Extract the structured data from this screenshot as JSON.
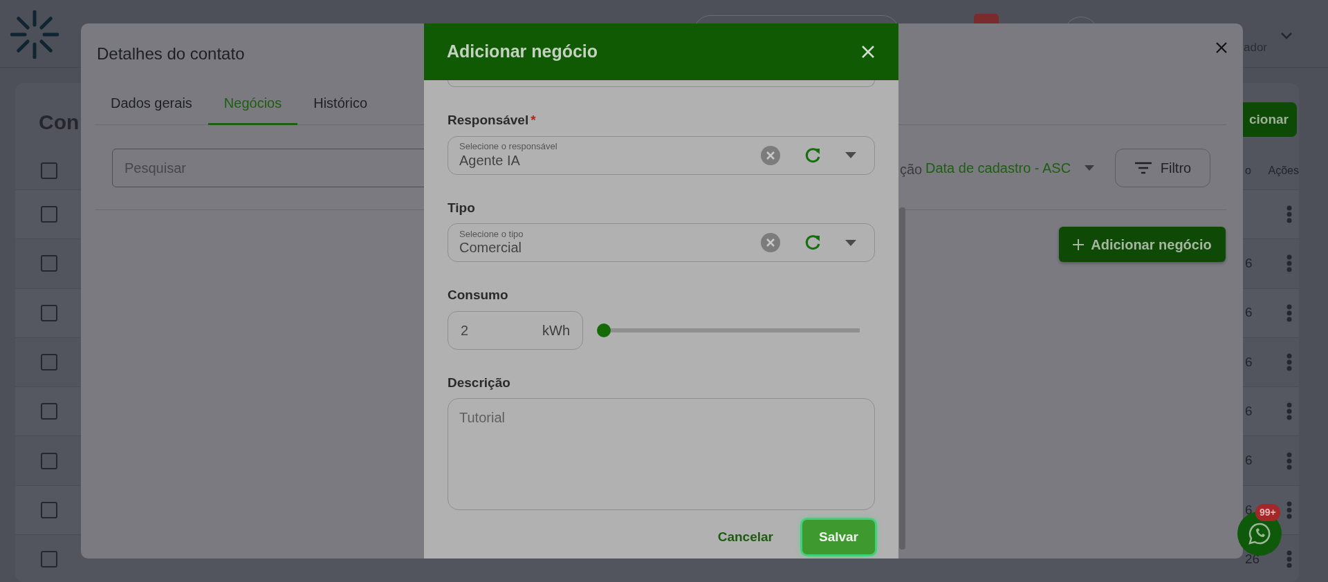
{
  "app": {
    "header": {
      "user_role": "ador"
    },
    "page_title": "Con",
    "add_button": "cionar",
    "table": {
      "columns": [
        "o",
        "Ações"
      ],
      "header_checked": false,
      "rows": [
        {
          "checked": false
        },
        {
          "checked": false,
          "date": "6"
        },
        {
          "checked": false,
          "date": "6"
        },
        {
          "checked": false,
          "date": "6"
        },
        {
          "checked": false,
          "date": "6"
        },
        {
          "checked": false,
          "date": "6"
        },
        {
          "checked": false,
          "date": "6"
        },
        {
          "checked": false,
          "date": "26"
        }
      ]
    },
    "whatsapp_badge": "99+"
  },
  "contact_modal": {
    "title": "Detalhes do contato",
    "tabs": [
      {
        "label": "Dados gerais",
        "selected": false
      },
      {
        "label": "Negócios",
        "selected": true
      },
      {
        "label": "Histórico",
        "selected": false
      }
    ],
    "search": {
      "placeholder": "Pesquisar"
    },
    "sort_label": "ção",
    "sort_value": "Data de cadastro - ASC",
    "filter_button": "Filtro",
    "add_deal_button": "Adicionar negócio"
  },
  "deal_modal": {
    "title": "Adicionar negócio",
    "responsavel": {
      "label": "Responsável",
      "required_mark": "*",
      "floating_label": "Selecione o responsável",
      "value": "Agente IA"
    },
    "tipo": {
      "label": "Tipo",
      "floating_label": "Selecione o tipo",
      "value": "Comercial"
    },
    "consumo": {
      "label": "Consumo",
      "value": "2",
      "unit": "kWh",
      "level": 0
    },
    "descricao": {
      "label": "Descrição",
      "placeholder": "Tutorial"
    },
    "buttons": {
      "cancel": "Cancelar",
      "save": "Salvar"
    }
  }
}
